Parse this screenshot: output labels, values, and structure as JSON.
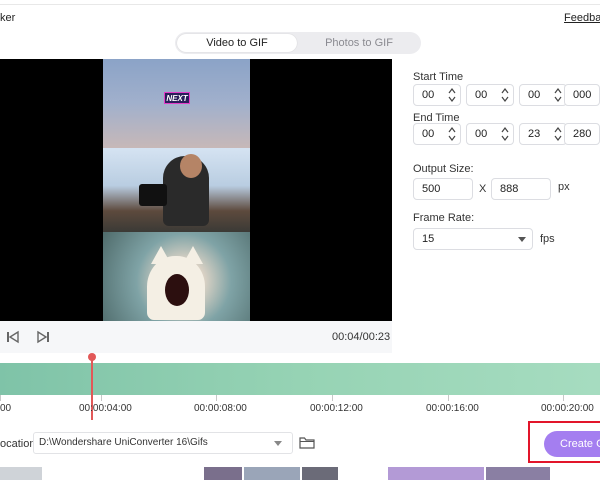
{
  "app": {
    "title_fragment": "ker",
    "feedback_label": "Feedback"
  },
  "mode_tabs": [
    {
      "label": "Video to GIF",
      "active": true
    },
    {
      "label": "Photos to GIF",
      "active": false
    }
  ],
  "preview": {
    "overlay_text": "NEXT"
  },
  "player": {
    "time": "00:04/00:23"
  },
  "settings": {
    "start_time": {
      "label": "Start Time",
      "hh": "00",
      "mm": "00",
      "ss": "00",
      "ms": "000"
    },
    "end_time": {
      "label": "End Time",
      "hh": "00",
      "mm": "00",
      "ss": "23",
      "ms": "280"
    },
    "output_size": {
      "label": "Output Size:",
      "width": "500",
      "separator": "X",
      "height": "888",
      "unit": "px"
    },
    "frame_rate": {
      "label": "Frame Rate:",
      "value": "15",
      "unit": "fps"
    }
  },
  "timeline": {
    "tick_labels": [
      "00",
      "00:00:04:00",
      "00:00:08:00",
      "00:00:12:00",
      "00:00:16:00",
      "00:00:20:00"
    ],
    "playhead_time": "00:00:04:00"
  },
  "output": {
    "location_label": "ocation:",
    "location_path": "D:\\Wondershare UniConverter 16\\Gifs",
    "create_button": "Create GIF"
  },
  "colors": {
    "accent": "#a47ef0",
    "highlight_box": "#e2152a",
    "playhead": "#e25858",
    "timeline": "#96d3b4"
  }
}
